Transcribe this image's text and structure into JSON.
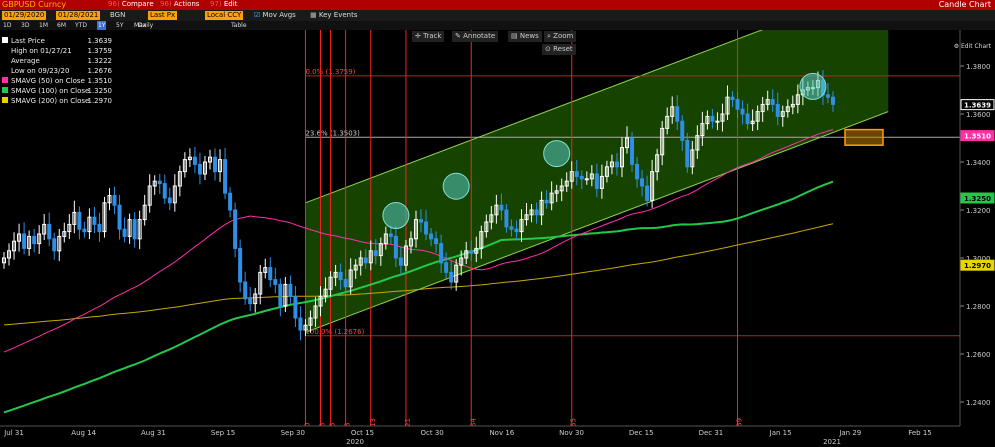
{
  "header": {
    "ticker": "GBPUSD Curncy",
    "chart_type": "Candle Chart"
  },
  "toolbar": {
    "from_date": "01/29/2020",
    "to_date": "01/28/2021",
    "source": "BGN",
    "field": "Last Px",
    "currency": "Local CCY",
    "compare": "Compare",
    "actions": "Actions",
    "edit": "Edit",
    "mov_avgs": "Mov Avgs",
    "key_events": "Key Events",
    "period": "Daily",
    "table": "Table",
    "edit_chart": "Edit Chart"
  },
  "timeframes": [
    "1D",
    "3D",
    "1M",
    "6M",
    "YTD",
    "1Y",
    "5Y",
    "Max"
  ],
  "selected_timeframe": "1Y",
  "legend": {
    "last_price": {
      "label": "Last Price",
      "value": "1.3639"
    },
    "high": {
      "label": "High on 01/27/21",
      "value": "1.3759"
    },
    "average": {
      "label": "Average",
      "value": "1.3222"
    },
    "low": {
      "label": "Low on 09/23/20",
      "value": "1.2676"
    },
    "sma50": {
      "label": "SMAVG (50)  on Close",
      "value": "1.3510",
      "color": "#ff2fa8"
    },
    "sma100": {
      "label": "SMAVG (100)  on Close",
      "value": "1.3250",
      "color": "#22c84a"
    },
    "sma200": {
      "label": "SMAVG (200)  on Close",
      "value": "1.2970",
      "color": "#e8d400"
    }
  },
  "chart_tools": {
    "track": "Track",
    "annotate": "Annotate",
    "news": "News",
    "zoom": "Zoom",
    "reset": "Reset"
  },
  "colors": {
    "up": "#ffffff",
    "down": "#2e8fe6",
    "channel": "#1f5a00",
    "channel_line": "#8cd04a",
    "marker": "#ff2020"
  },
  "chart_data": {
    "type": "candlestick",
    "title": "GBPUSD Curncy",
    "ylim": [
      1.23,
      1.395
    ],
    "y_ticks": [
      "1.2400",
      "1.2600",
      "1.2800",
      "1.3000",
      "1.3200",
      "1.3400",
      "1.3600",
      "1.3800"
    ],
    "x_tick_labels": [
      "Jul 31",
      "Aug 14",
      "Aug 31",
      "Sep 15",
      "Sep 30",
      "Oct 15",
      "Oct 30",
      "Nov 16",
      "Nov 30",
      "Dec 15",
      "Dec 31",
      "Jan 15",
      "Jan 29",
      "Feb 15"
    ],
    "x_sub_labels": [
      "2020",
      "2021"
    ],
    "price_tags": [
      {
        "value": "1.3639",
        "y": 1.3639,
        "bg": "#000000",
        "fg": "#ffffff"
      },
      {
        "value": "1.3510",
        "y": 1.351,
        "bg": "#ff2fa8",
        "fg": "#ffffff"
      },
      {
        "value": "1.3250",
        "y": 1.325,
        "bg": "#22c84a",
        "fg": "#000000"
      },
      {
        "value": "1.2970",
        "y": 1.297,
        "bg": "#e8d400",
        "fg": "#000000"
      }
    ],
    "fib_levels": [
      {
        "label": "0.0% (1.3759)",
        "y": 1.3759
      },
      {
        "label": "23.6% (1.3503)",
        "y": 1.3503
      },
      {
        "label": "100.0% (1.2676)",
        "y": 1.2676
      }
    ],
    "event_markers": [
      "0",
      "3",
      "5",
      "8",
      "13",
      "21",
      "34",
      "55",
      "89"
    ],
    "closes": [
      1.3,
      1.303,
      1.307,
      1.31,
      1.304,
      1.309,
      1.306,
      1.31,
      1.314,
      1.308,
      1.303,
      1.309,
      1.311,
      1.314,
      1.319,
      1.312,
      1.311,
      1.317,
      1.314,
      1.311,
      1.323,
      1.326,
      1.322,
      1.312,
      1.309,
      1.316,
      1.308,
      1.316,
      1.322,
      1.33,
      1.332,
      1.331,
      1.325,
      1.323,
      1.33,
      1.336,
      1.341,
      1.342,
      1.339,
      1.335,
      1.34,
      1.342,
      1.336,
      1.341,
      1.327,
      1.32,
      1.304,
      1.29,
      1.283,
      1.281,
      1.285,
      1.294,
      1.296,
      1.291,
      1.289,
      1.28,
      1.289,
      1.284,
      1.275,
      1.27,
      1.272,
      1.275,
      1.28,
      1.284,
      1.287,
      1.292,
      1.294,
      1.291,
      1.288,
      1.295,
      1.297,
      1.3,
      1.298,
      1.303,
      1.301,
      1.306,
      1.31,
      1.309,
      1.3,
      1.297,
      1.305,
      1.308,
      1.316,
      1.315,
      1.31,
      1.308,
      1.306,
      1.298,
      1.294,
      1.29,
      1.297,
      1.3,
      1.303,
      1.302,
      1.304,
      1.311,
      1.315,
      1.318,
      1.322,
      1.32,
      1.313,
      1.312,
      1.311,
      1.316,
      1.318,
      1.32,
      1.318,
      1.324,
      1.323,
      1.327,
      1.328,
      1.33,
      1.332,
      1.336,
      1.334,
      1.333,
      1.333,
      1.335,
      1.329,
      1.334,
      1.338,
      1.34,
      1.338,
      1.346,
      1.35,
      1.339,
      1.333,
      1.33,
      1.324,
      1.336,
      1.343,
      1.354,
      1.359,
      1.363,
      1.357,
      1.349,
      1.338,
      1.345,
      1.351,
      1.356,
      1.359,
      1.357,
      1.357,
      1.36,
      1.367,
      1.366,
      1.362,
      1.36,
      1.356,
      1.357,
      1.361,
      1.364,
      1.366,
      1.364,
      1.359,
      1.361,
      1.363,
      1.364,
      1.368,
      1.37,
      1.371,
      1.371,
      1.374,
      1.368,
      1.367,
      1.364
    ]
  }
}
